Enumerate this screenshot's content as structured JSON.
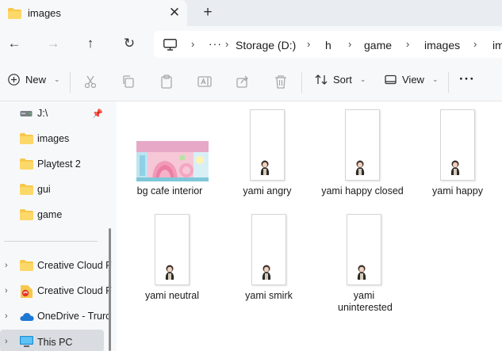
{
  "tab": {
    "title": "images",
    "close_glyph": "✕",
    "new_tab_glyph": "+"
  },
  "breadcrumb": [
    "Storage (D:)",
    "h",
    "game",
    "images",
    "im"
  ],
  "breadcrumb_more": "···",
  "commands": {
    "new": "New",
    "sort": "Sort",
    "view": "View",
    "more": "···"
  },
  "sidebar": {
    "quick_access": [
      {
        "label": "J:\\",
        "icon": "drive-icon",
        "pinned": true
      },
      {
        "label": "images",
        "icon": "folder-icon"
      },
      {
        "label": "Playtest 2",
        "icon": "folder-icon"
      },
      {
        "label": "gui",
        "icon": "folder-icon"
      },
      {
        "label": "game",
        "icon": "folder-icon"
      }
    ],
    "locations": [
      {
        "label": "Creative Cloud F",
        "icon": "folder-icon"
      },
      {
        "label": "Creative Cloud F",
        "icon": "creative-cloud-icon"
      },
      {
        "label": "OneDrive - Truro",
        "icon": "onedrive-icon"
      },
      {
        "label": "This PC",
        "icon": "pc-icon",
        "selected": true
      }
    ]
  },
  "files": [
    {
      "name": "bg cafe interior",
      "kind": "image-wide"
    },
    {
      "name": "yami angry",
      "kind": "sprite"
    },
    {
      "name": "yami happy closed",
      "kind": "sprite"
    },
    {
      "name": "yami happy",
      "kind": "sprite"
    },
    {
      "name": "yami neutral",
      "kind": "sprite"
    },
    {
      "name": "yami smirk",
      "kind": "sprite"
    },
    {
      "name": "yami uninterested",
      "kind": "sprite"
    }
  ],
  "colors": {
    "accent": "#1a73e8",
    "folder": "#f8c84a",
    "selection": "#d9dce1"
  }
}
